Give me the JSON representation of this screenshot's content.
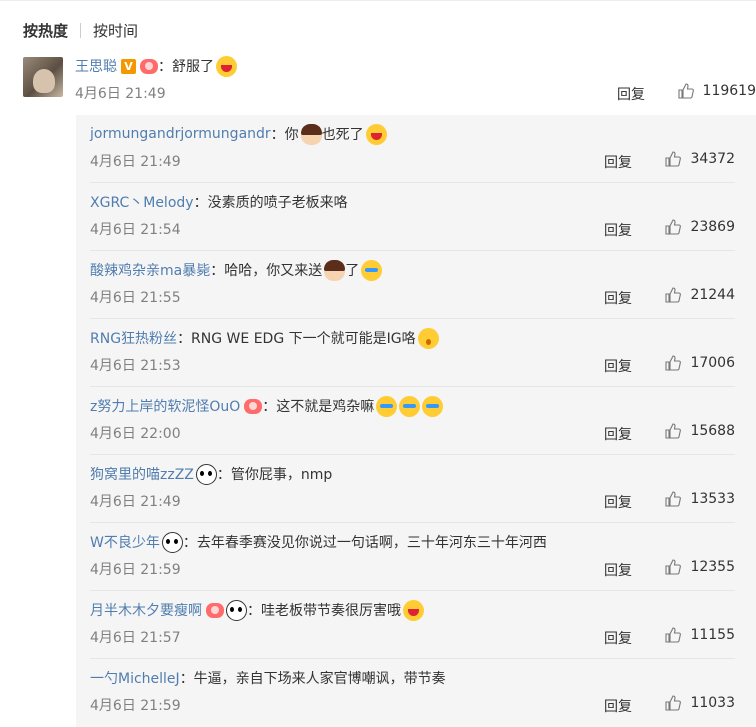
{
  "sort_tabs": {
    "active": "按热度",
    "inactive": "按时间"
  },
  "main_comment": {
    "user": "王思聪",
    "text": "：舒服了",
    "time": "4月6日 21:49",
    "reply_label": "回复",
    "likes": "119619"
  },
  "replies": [
    {
      "user": "jormungandrjormungandr",
      "text_before": "：你",
      "text_after": "也死了",
      "time": "4月6日 21:49",
      "reply_label": "回复",
      "likes": "34372"
    },
    {
      "user": "XGRC丶Melody",
      "text_before": "：没素质的喷子老板来咯",
      "text_after": "",
      "time": "4月6日 21:54",
      "reply_label": "回复",
      "likes": "23869"
    },
    {
      "user": "酸辣鸡杂亲ma暴毙",
      "text_before": "：哈哈，你又来送",
      "text_after": " 了",
      "time": "4月6日 21:55",
      "reply_label": "回复",
      "likes": "21244"
    },
    {
      "user": "RNG狂热粉丝",
      "text_before": "：RNG WE EDG 下一个就可能是IG咯",
      "text_after": "",
      "time": "4月6日 21:53",
      "reply_label": "回复",
      "likes": "17006"
    },
    {
      "user": "z努力上岸的软泥怪OuO",
      "text_before": "：这不就是鸡杂嘛",
      "text_after": "",
      "time": "4月6日 22:00",
      "reply_label": "回复",
      "likes": "15688"
    },
    {
      "user": "狗窝里的喵zzZZ",
      "text_before": "：管你屁事，nmp",
      "text_after": "",
      "time": "4月6日 21:49",
      "reply_label": "回复",
      "likes": "13533"
    },
    {
      "user": "W不良少年",
      "text_before": "：去年春季赛没见你说过一句话啊，三十年河东三十年河西",
      "text_after": "",
      "time": "4月6日 21:59",
      "reply_label": "回复",
      "likes": "12355"
    },
    {
      "user": "月半木木夕要瘦啊",
      "text_before": "：哇老板带节奏很厉害哦",
      "text_after": "",
      "time": "4月6日 21:57",
      "reply_label": "回复",
      "likes": "11155"
    },
    {
      "user": "一勺MichelleJ",
      "text_before": "：牛逼，亲自下场来人家官博嘲讽，带节奏",
      "text_after": "",
      "time": "4月6日 21:59",
      "reply_label": "回复",
      "likes": "11033"
    }
  ],
  "colors": {
    "username": "#507daf",
    "time": "#808080",
    "reply_bg": "#f5f5f5",
    "vip_badge": "#f39800"
  },
  "icons": {
    "like": "thumbs-up-icon",
    "vip": "v-badge-icon",
    "fan": "fan-badge-icon"
  }
}
